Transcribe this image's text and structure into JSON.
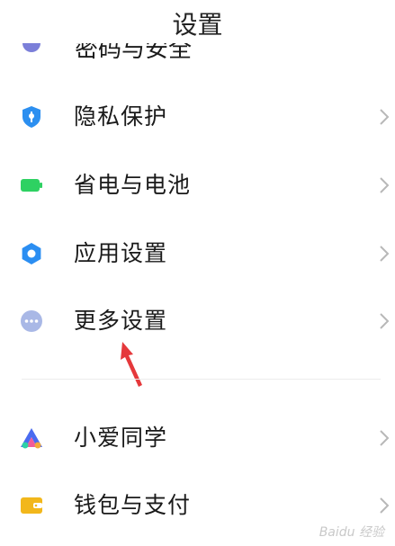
{
  "header": {
    "title": "设置"
  },
  "clipped_item": {
    "label": "密码与安全"
  },
  "items": [
    {
      "label": "隐私保护",
      "icon": "privacy-shield-icon",
      "color": "#2c8ff0"
    },
    {
      "label": "省电与电池",
      "icon": "battery-icon",
      "color": "#2ed162"
    },
    {
      "label": "应用设置",
      "icon": "gear-icon",
      "color": "#2b8ef2"
    },
    {
      "label": "更多设置",
      "icon": "more-dots-icon",
      "color": "#a9b8e6"
    },
    {
      "label": "小爱同学",
      "icon": "xiaoai-icon",
      "color": "#4a6bf0"
    },
    {
      "label": "钱包与支付",
      "icon": "wallet-icon",
      "color": "#f2b71b"
    }
  ],
  "annotation": {
    "color": "#e5383b"
  },
  "watermark": "Baidu 经验"
}
